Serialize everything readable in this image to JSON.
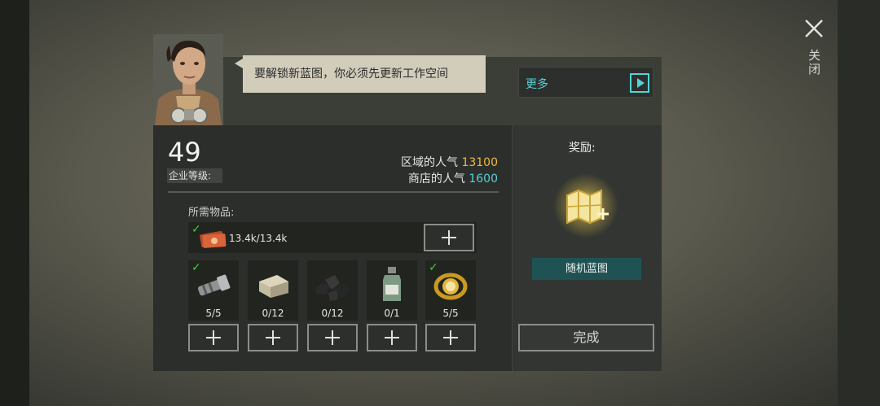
{
  "close": {
    "label": "关闭",
    "icon": "close-icon"
  },
  "speech": {
    "text": "要解锁新蓝图，你必须先更新工作空间"
  },
  "more": {
    "label": "更多",
    "icon": "play-icon"
  },
  "level": {
    "value": "49",
    "label": "企业等级:"
  },
  "popularity": {
    "region_label": "区域的人气",
    "region_value": "13100",
    "shop_label": "商店的人气",
    "shop_value": "1600"
  },
  "required": {
    "label": "所需物品:",
    "money": {
      "amount": "13.4k/13.4k",
      "icon": "cash-bundle-icon",
      "complete": true
    },
    "items": [
      {
        "icon": "flashlight-icon",
        "count": "5/5",
        "complete": true
      },
      {
        "icon": "stone-block-icon",
        "count": "0/12",
        "complete": false
      },
      {
        "icon": "coal-icon",
        "count": "0/12",
        "complete": false
      },
      {
        "icon": "bottle-icon",
        "count": "0/1",
        "complete": false
      },
      {
        "icon": "gold-watch-icon",
        "count": "5/5",
        "complete": true
      }
    ]
  },
  "reward": {
    "title": "奖励:",
    "icon": "blueprint-map-icon",
    "name": "随机蓝图"
  },
  "complete_button": {
    "label": "完成"
  },
  "colors": {
    "accent_cyan": "#55d2d8",
    "accent_gold": "#f0b93a",
    "check_green": "#3bd13b",
    "reward_label_bg": "#1f5353"
  }
}
